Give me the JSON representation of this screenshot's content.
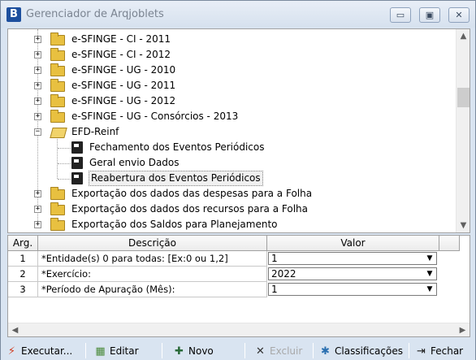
{
  "window": {
    "icon_letter": "B",
    "title": "Gerenciador de Arqjoblets",
    "minimize": "▭",
    "maximize": "▣",
    "close": "✕"
  },
  "tree": {
    "items": [
      {
        "label": "e-SFINGE - CI - 2011",
        "type": "folder",
        "expander": "+"
      },
      {
        "label": "e-SFINGE - CI - 2012",
        "type": "folder",
        "expander": "+"
      },
      {
        "label": "e-SFINGE - UG - 2010",
        "type": "folder",
        "expander": "+"
      },
      {
        "label": "e-SFINGE - UG - 2011",
        "type": "folder",
        "expander": "+"
      },
      {
        "label": "e-SFINGE - UG - 2012",
        "type": "folder",
        "expander": "+"
      },
      {
        "label": "e-SFINGE - UG - Consórcios - 2013",
        "type": "folder",
        "expander": "+"
      },
      {
        "label": "EFD-Reinf",
        "type": "open-folder",
        "expander": "−"
      },
      {
        "label": "Fechamento dos Eventos Periódicos",
        "type": "document"
      },
      {
        "label": "Geral envio Dados",
        "type": "document"
      },
      {
        "label": "Reabertura dos Eventos Periódicos",
        "type": "document",
        "selected": true
      },
      {
        "label": "Exportação dos dados das despesas para a Folha",
        "type": "folder",
        "expander": "+"
      },
      {
        "label": "Exportação dos dados dos recursos para a Folha",
        "type": "folder",
        "expander": "+"
      },
      {
        "label": "Exportação dos Saldos para Planejamento",
        "type": "folder",
        "expander": "+"
      }
    ]
  },
  "grid": {
    "headers": {
      "arg": "Arg.",
      "descricao": "Descrição",
      "valor": "Valor"
    },
    "rows": [
      {
        "arg": "1",
        "descricao": "*Entidade(s) 0 para todas: [Ex:0 ou 1,2]",
        "valor": "1"
      },
      {
        "arg": "2",
        "descricao": "*Exercício:",
        "valor": "2022"
      },
      {
        "arg": "3",
        "descricao": "*Período de Apuração (Mês):",
        "valor": "1"
      }
    ]
  },
  "toolbar": {
    "executar": "Executar...",
    "editar": "Editar",
    "novo": "Novo",
    "excluir": "Excluir",
    "classificacoes": "Classificações",
    "fechar": "Fechar"
  },
  "colors": {
    "titlebar": "#d6e1ee",
    "window_bg": "#d9e4f1",
    "folder": "#e8c040",
    "accent": "#1d4f9e"
  }
}
